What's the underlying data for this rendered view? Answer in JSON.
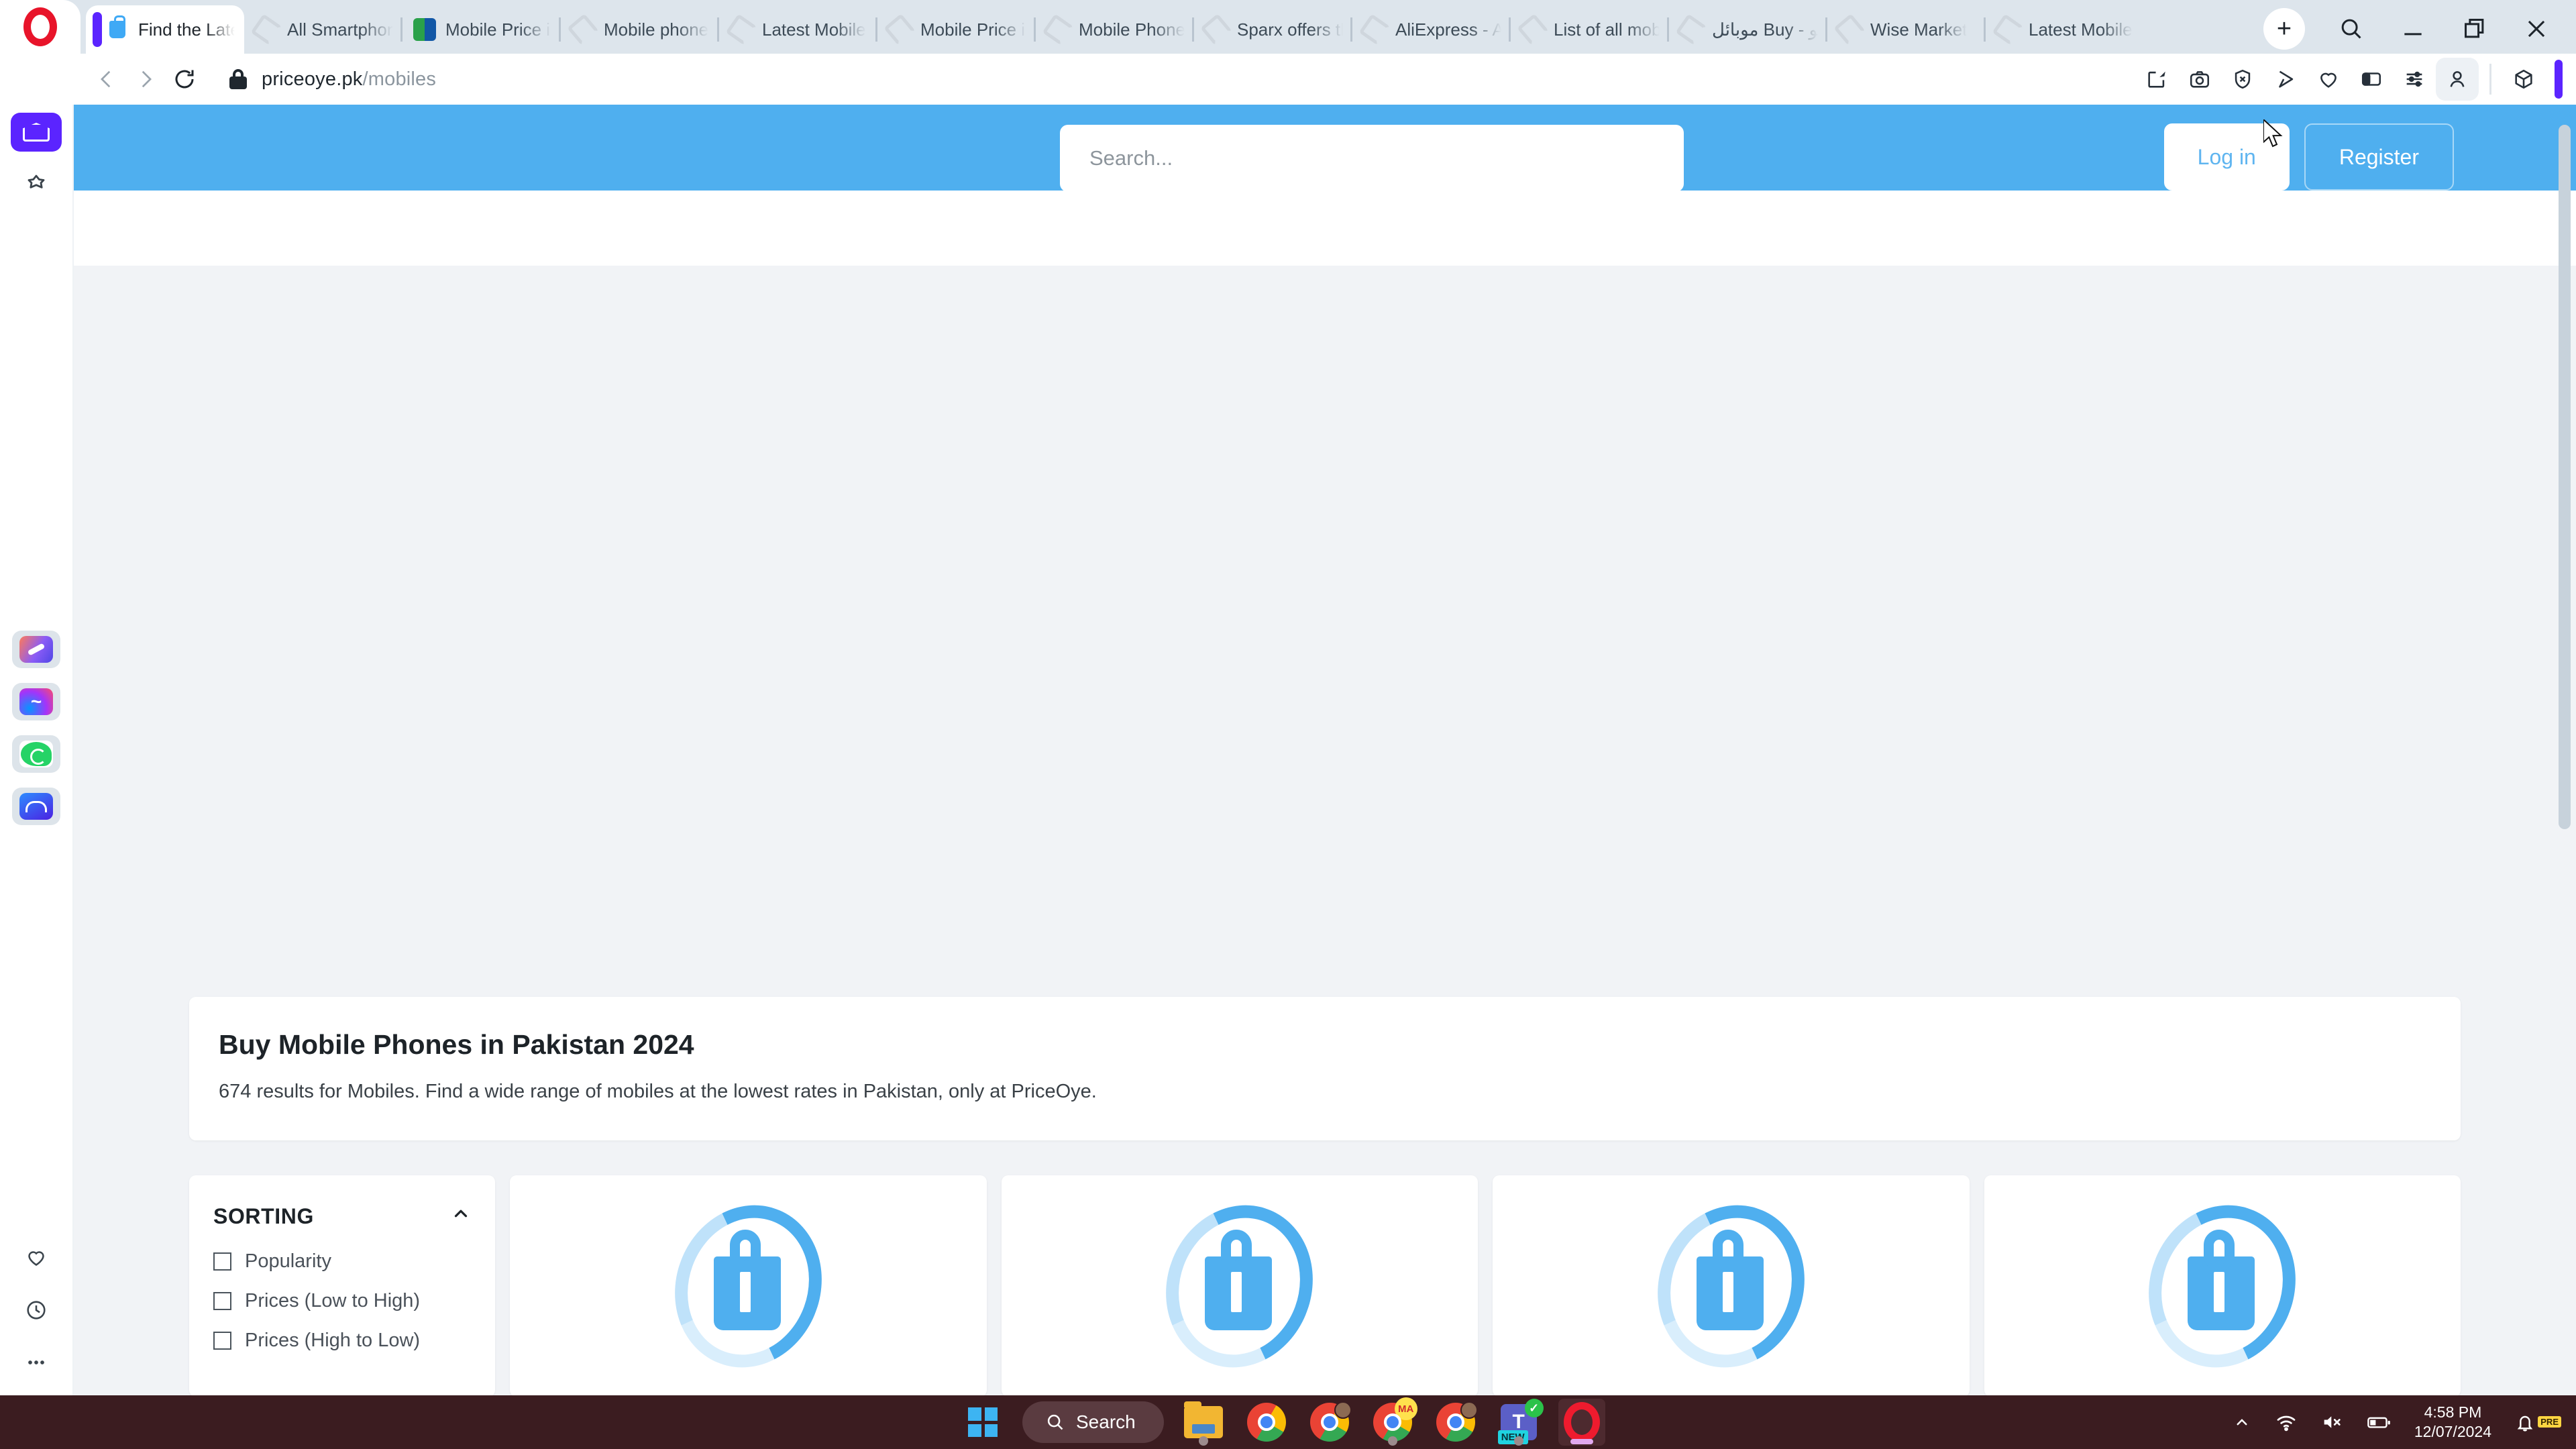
{
  "browser": {
    "name": "Opera",
    "tabs": [
      {
        "title": "Find the Latest Mobile P",
        "favicon": "priceoye-icon",
        "active": true
      },
      {
        "title": "All Smartphon",
        "favicon": "loading-spinner-icon",
        "active": false
      },
      {
        "title": "Mobile Price in",
        "favicon": "techjuice-icon",
        "active": false
      },
      {
        "title": "Mobile phone",
        "favicon": "loading-spinner-icon",
        "active": false
      },
      {
        "title": "Latest Mobile",
        "favicon": "loading-spinner-icon",
        "active": false
      },
      {
        "title": "Mobile Price in",
        "favicon": "loading-spinner-icon",
        "active": false
      },
      {
        "title": "Mobile Phone",
        "favicon": "loading-spinner-icon",
        "active": false
      },
      {
        "title": "Sparx offers th",
        "favicon": "loading-spinner-icon",
        "active": false
      },
      {
        "title": "AliExpress - Af",
        "favicon": "loading-spinner-icon",
        "active": false
      },
      {
        "title": "List of all mobi",
        "favicon": "loading-spinner-icon",
        "active": false
      },
      {
        "title": "موبائل Buy - مو",
        "favicon": "loading-spinner-icon",
        "active": false
      },
      {
        "title": "Wise Market",
        "favicon": "loading-spinner-icon",
        "active": false
      },
      {
        "title": "Latest Mobile",
        "favicon": "loading-spinner-icon",
        "active": false
      }
    ],
    "new_tab_label": "+",
    "window_controls": [
      "tab-search-icon",
      "minimize-icon",
      "restore-icon",
      "close-icon"
    ],
    "address": {
      "domain": "priceoye.pk",
      "path": "/mobiles",
      "security": "lock-icon"
    },
    "toolbar_icons": [
      "snapshot-edit-icon",
      "screenshot-camera-icon",
      "ad-blocker-shield-icon",
      "send-to-device-icon",
      "heart-favorites-icon",
      "sidebar-panel-icon",
      "easy-setup-sliders-icon",
      "profile-account-icon",
      "extensions-cube-icon"
    ],
    "sidebar_icons": [
      "home-icon",
      "bookmarks-star-icon",
      "aria-ai-icon",
      "messenger-icon",
      "whatsapp-icon",
      "music-player-icon",
      "pinboards-heart-icon",
      "history-clock-icon",
      "more-options-icon"
    ]
  },
  "site": {
    "search": {
      "placeholder": "Search..."
    },
    "login_label": "Log in",
    "register_label": "Register",
    "accent_color": "#4fafef",
    "result_title": "Buy Mobile Phones in Pakistan 2024",
    "result_subtitle": "674 results for Mobiles. Find a wide range of mobiles at the lowest rates in Pakistan, only at PriceOye.",
    "results_count": "674",
    "sorting": {
      "title": "SORTING",
      "collapse_icon": "chevron-up-icon",
      "options": [
        {
          "label": "Popularity",
          "checked": false
        },
        {
          "label": "Prices (Low to High)",
          "checked": false
        },
        {
          "label": "Prices (High to Low)",
          "checked": false
        }
      ]
    },
    "product_cards": [
      {
        "placeholder": "priceoye-logo-placeholder"
      },
      {
        "placeholder": "priceoye-logo-placeholder"
      },
      {
        "placeholder": "priceoye-logo-placeholder"
      },
      {
        "placeholder": "priceoye-logo-placeholder"
      }
    ]
  },
  "taskbar": {
    "start_label": "start-button",
    "search_label": "Search",
    "apps": [
      "file-explorer-icon",
      "chrome-icon",
      "chrome-profile-icon",
      "chrome-ma-icon",
      "chrome-profile2-icon",
      "microsoft-teams-icon",
      "opera-icon"
    ],
    "teams_badge": "NEW",
    "tray": {
      "overflow": "show-hidden-icons-chevron",
      "wifi": "wifi-icon",
      "volume": "volume-muted-icon",
      "battery": "battery-icon",
      "time": "4:58 PM",
      "date": "12/07/2024",
      "notifications": "bell-notification-icon",
      "copilot": "copilot-icon",
      "copilot_badge": "PRE"
    }
  }
}
